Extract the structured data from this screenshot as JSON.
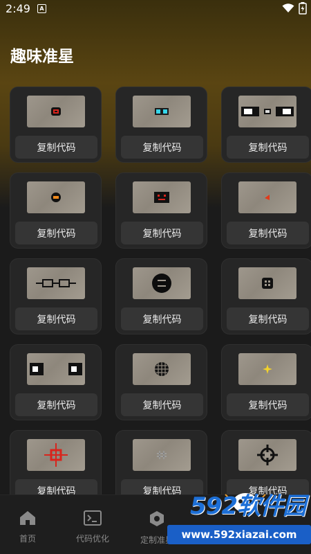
{
  "status_bar": {
    "time": "2:49",
    "sim_label": "A"
  },
  "page": {
    "title": "趣味准星"
  },
  "cards": [
    {
      "copy_label": "复制代码",
      "crosshair": "red-square-icon"
    },
    {
      "copy_label": "复制代码",
      "crosshair": "cyan-rectangle-icon"
    },
    {
      "copy_label": "复制代码",
      "crosshair": "three-boxes-icon"
    },
    {
      "copy_label": "复制代码",
      "crosshair": "orange-dot-icon"
    },
    {
      "copy_label": "复制代码",
      "crosshair": "red-face-icon"
    },
    {
      "copy_label": "复制代码",
      "crosshair": "red-arrow-icon"
    },
    {
      "copy_label": "复制代码",
      "crosshair": "glasses-icon"
    },
    {
      "copy_label": "复制代码",
      "crosshair": "black-circle-face-icon"
    },
    {
      "copy_label": "复制代码",
      "crosshair": "small-grid-icon"
    },
    {
      "copy_label": "复制代码",
      "crosshair": "two-eyes-icon"
    },
    {
      "copy_label": "复制代码",
      "crosshair": "globe-icon"
    },
    {
      "copy_label": "复制代码",
      "crosshair": "yellow-star-icon"
    },
    {
      "copy_label": "复制代码",
      "crosshair": "red-crosshair-icon"
    },
    {
      "copy_label": "复制代码",
      "crosshair": "hash-icon"
    },
    {
      "copy_label": "复制代码",
      "crosshair": "black-cross-icon"
    }
  ],
  "bottom_nav": [
    {
      "label": "首页",
      "icon": "home-icon"
    },
    {
      "label": "代码优化",
      "icon": "terminal-icon"
    },
    {
      "label": "定制准星",
      "icon": "hexagon-icon"
    }
  ],
  "watermark": {
    "brand": "592软件园",
    "url": "www.592xiazai.com"
  },
  "colors": {
    "accent_gradient": "#5a4512",
    "background": "#1b1b1b",
    "card": "#262626",
    "button": "#353535"
  }
}
